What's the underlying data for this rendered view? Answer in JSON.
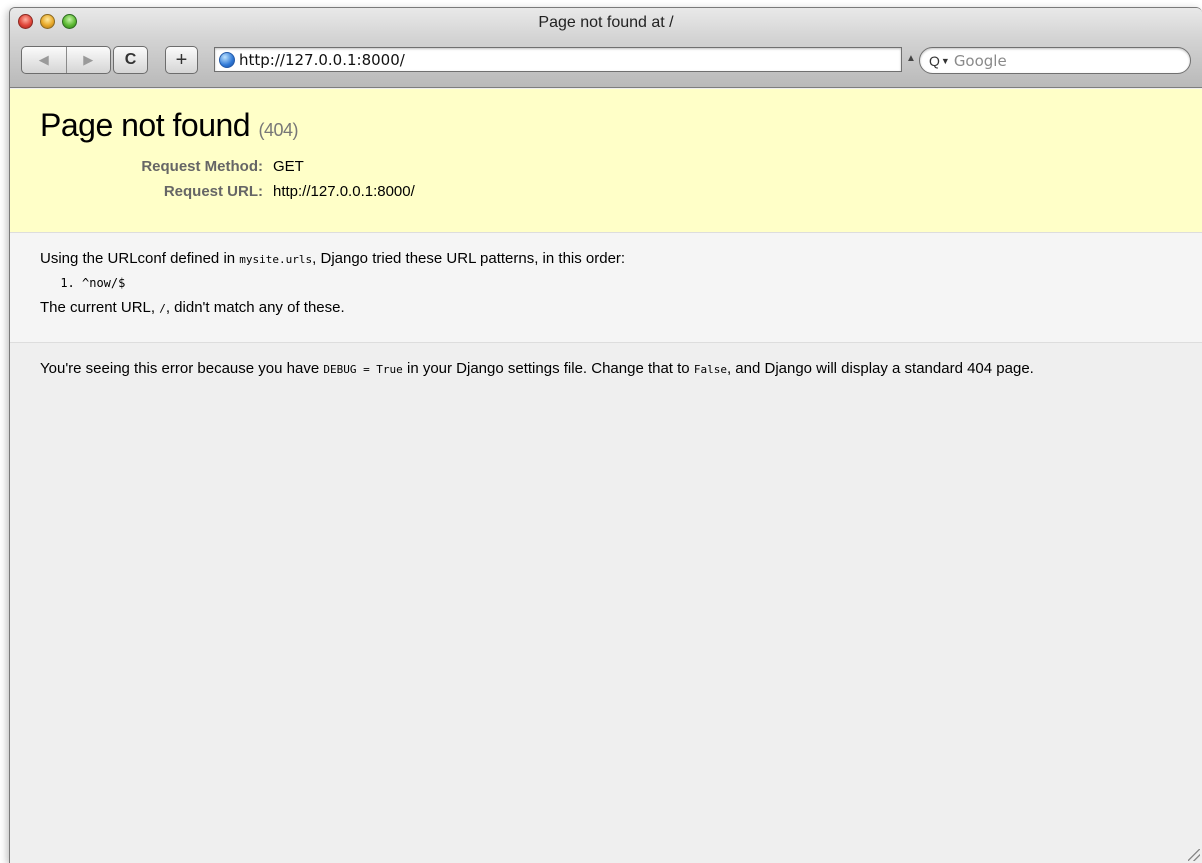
{
  "window": {
    "title": "Page not found at /"
  },
  "toolbar": {
    "back_glyph": "◀",
    "forward_glyph": "▶",
    "reload_glyph": "C",
    "add_glyph": "+",
    "url": "http://127.0.0.1:8000/",
    "search_placeholder": "Google"
  },
  "error": {
    "heading": "Page not found",
    "status_code": "(404)",
    "meta": [
      {
        "label": "Request Method:",
        "value": "GET"
      },
      {
        "label": "Request URL:",
        "value": "http://127.0.0.1:8000/"
      }
    ]
  },
  "info": {
    "intro_before": "Using the URLconf defined in ",
    "intro_module": "mysite.urls",
    "intro_after": ", Django tried these URL patterns, in this order:",
    "patterns": [
      "^now/$"
    ],
    "current_before": "The current URL, ",
    "current_url": "/",
    "current_after": ", didn't match any of these."
  },
  "explanation": {
    "part1": "You're seeing this error because you have ",
    "debug_code": "DEBUG = True",
    "part2": " in your Django settings file. Change that to ",
    "false_code": "False",
    "part3": ", and Django will display a standard 404 page."
  }
}
